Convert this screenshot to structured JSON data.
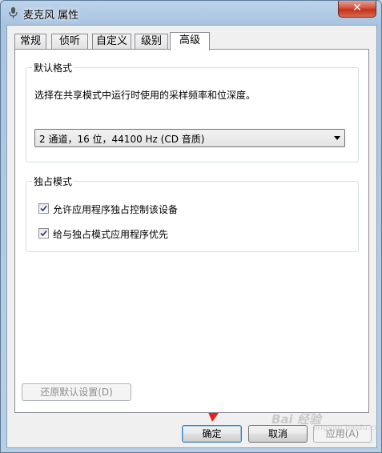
{
  "window": {
    "title": "麦克风 属性",
    "close_glyph": "✕"
  },
  "tabs": [
    {
      "label": "常规"
    },
    {
      "label": "侦听"
    },
    {
      "label": "自定义"
    },
    {
      "label": "级别"
    },
    {
      "label": "高级",
      "active": true
    }
  ],
  "default_format": {
    "title": "默认格式",
    "description": "选择在共享模式中运行时使用的采样频率和位深度。",
    "selected": "2 通道，16 位，44100 Hz (CD 音质)"
  },
  "exclusive_mode": {
    "title": "独占模式",
    "options": [
      {
        "label": "允许应用程序独占控制该设备",
        "checked": true
      },
      {
        "label": "给与独占模式应用程序优先",
        "checked": true
      }
    ]
  },
  "restore_button": {
    "label": "还原默认设置(D)",
    "enabled": false
  },
  "footer": {
    "ok_label": "确定",
    "cancel_label": "取消",
    "apply_label": "应用(A)",
    "apply_enabled": false
  },
  "annotation": {
    "arrow_color": "#e8201a"
  },
  "watermark": {
    "text": "Bai 经验",
    "sub": "jingyan.baidu.com"
  },
  "colors": {
    "window_frame": "#a9c4e1",
    "close_button": "#c1321c",
    "default_button_border": "#3c7fb1"
  }
}
